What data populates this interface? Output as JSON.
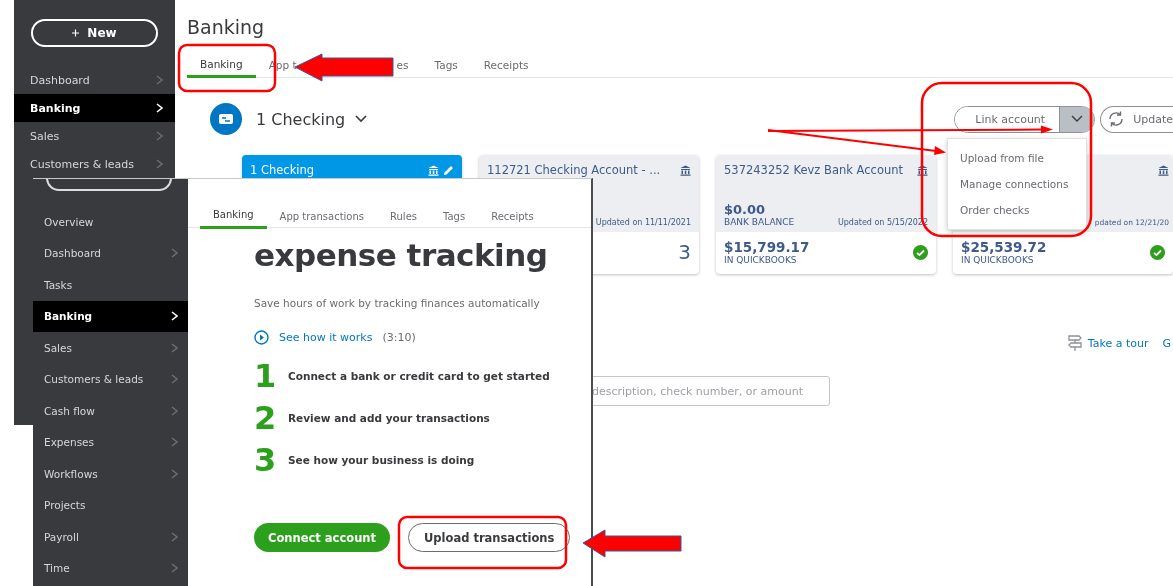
{
  "back_window": {
    "sidebar": {
      "new_button": "New",
      "items": [
        {
          "label": "Dashboard",
          "chevron": true,
          "selected": false
        },
        {
          "label": "Banking",
          "chevron": true,
          "selected": true
        },
        {
          "label": "Sales",
          "chevron": true,
          "selected": false
        },
        {
          "label": "Customers & leads",
          "chevron": true,
          "selected": false
        }
      ]
    },
    "title": "Banking",
    "tabs": [
      {
        "label": "Banking",
        "selected": true,
        "kind": "whole"
      },
      {
        "label": "App t",
        "selected": false,
        "kind": "cut_end"
      },
      {
        "label": "es",
        "selected": false,
        "kind": "cut_start"
      },
      {
        "label": "Tags",
        "selected": false,
        "kind": "whole"
      },
      {
        "label": "Receipts",
        "selected": false,
        "kind": "whole"
      }
    ],
    "account": {
      "name": "1 Checking"
    },
    "link_account": "Link account",
    "update_button": "Update",
    "menu": {
      "expanded": true,
      "items": [
        "Upload from file",
        "Manage connections",
        "Order checks"
      ]
    },
    "cards": [
      {
        "title": "1 Checking",
        "selected": true
      },
      {
        "title": "112721 Checking Account - ...",
        "selected": false,
        "updated": "Updated on 11/11/2021",
        "count": "3"
      },
      {
        "title": "537243252 Kevz Bank Account",
        "selected": false,
        "bank_balance": "$0.00",
        "balance_label": "BANK BALANCE",
        "updated": "Updated on 5/15/2022",
        "qb_balance": "$15,799.17",
        "qb_label": "IN QUICKBOOKS",
        "reconciled": true
      },
      {
        "selected": false,
        "updated": "pdated on 12/21/20",
        "qb_balance": "$25,539.72",
        "qb_label": "IN QUICKBOOKS",
        "reconciled": true
      }
    ],
    "tour_link": "Take a tour",
    "next_link": "G",
    "search": {
      "placeholder": "description, check number, or amount"
    }
  },
  "front_window": {
    "sidebar": {
      "items": [
        {
          "label": "Overview",
          "chevron": false,
          "selected": false
        },
        {
          "label": "Dashboard",
          "chevron": true,
          "selected": false
        },
        {
          "label": "Tasks",
          "chevron": false,
          "selected": false
        },
        {
          "label": "Banking",
          "chevron": true,
          "selected": true
        },
        {
          "label": "Sales",
          "chevron": true,
          "selected": false
        },
        {
          "label": "Customers & leads",
          "chevron": true,
          "selected": false
        },
        {
          "label": "Cash flow",
          "chevron": true,
          "selected": false
        },
        {
          "label": "Expenses",
          "chevron": true,
          "selected": false
        },
        {
          "label": "Workflows",
          "chevron": true,
          "selected": false
        },
        {
          "label": "Projects",
          "chevron": false,
          "selected": false
        },
        {
          "label": "Payroll",
          "chevron": true,
          "selected": false
        },
        {
          "label": "Time",
          "chevron": true,
          "selected": false
        }
      ]
    },
    "tabs": [
      {
        "label": "Banking",
        "selected": true
      },
      {
        "label": "App transactions",
        "selected": false
      },
      {
        "label": "Rules",
        "selected": false
      },
      {
        "label": "Tags",
        "selected": false
      },
      {
        "label": "Receipts",
        "selected": false
      }
    ],
    "heading": "expense tracking",
    "subtitle": "Save hours of work by tracking finances automatically",
    "video_link": "See how it works",
    "video_length": "(3:10)",
    "steps": [
      {
        "number": "1",
        "text": "Connect a bank or credit card to get started"
      },
      {
        "number": "2",
        "text": "Review and add your transactions"
      },
      {
        "number": "3",
        "text": "See how your business is doing"
      }
    ],
    "primary_button": "Connect account",
    "secondary_button": "Upload transactions"
  }
}
